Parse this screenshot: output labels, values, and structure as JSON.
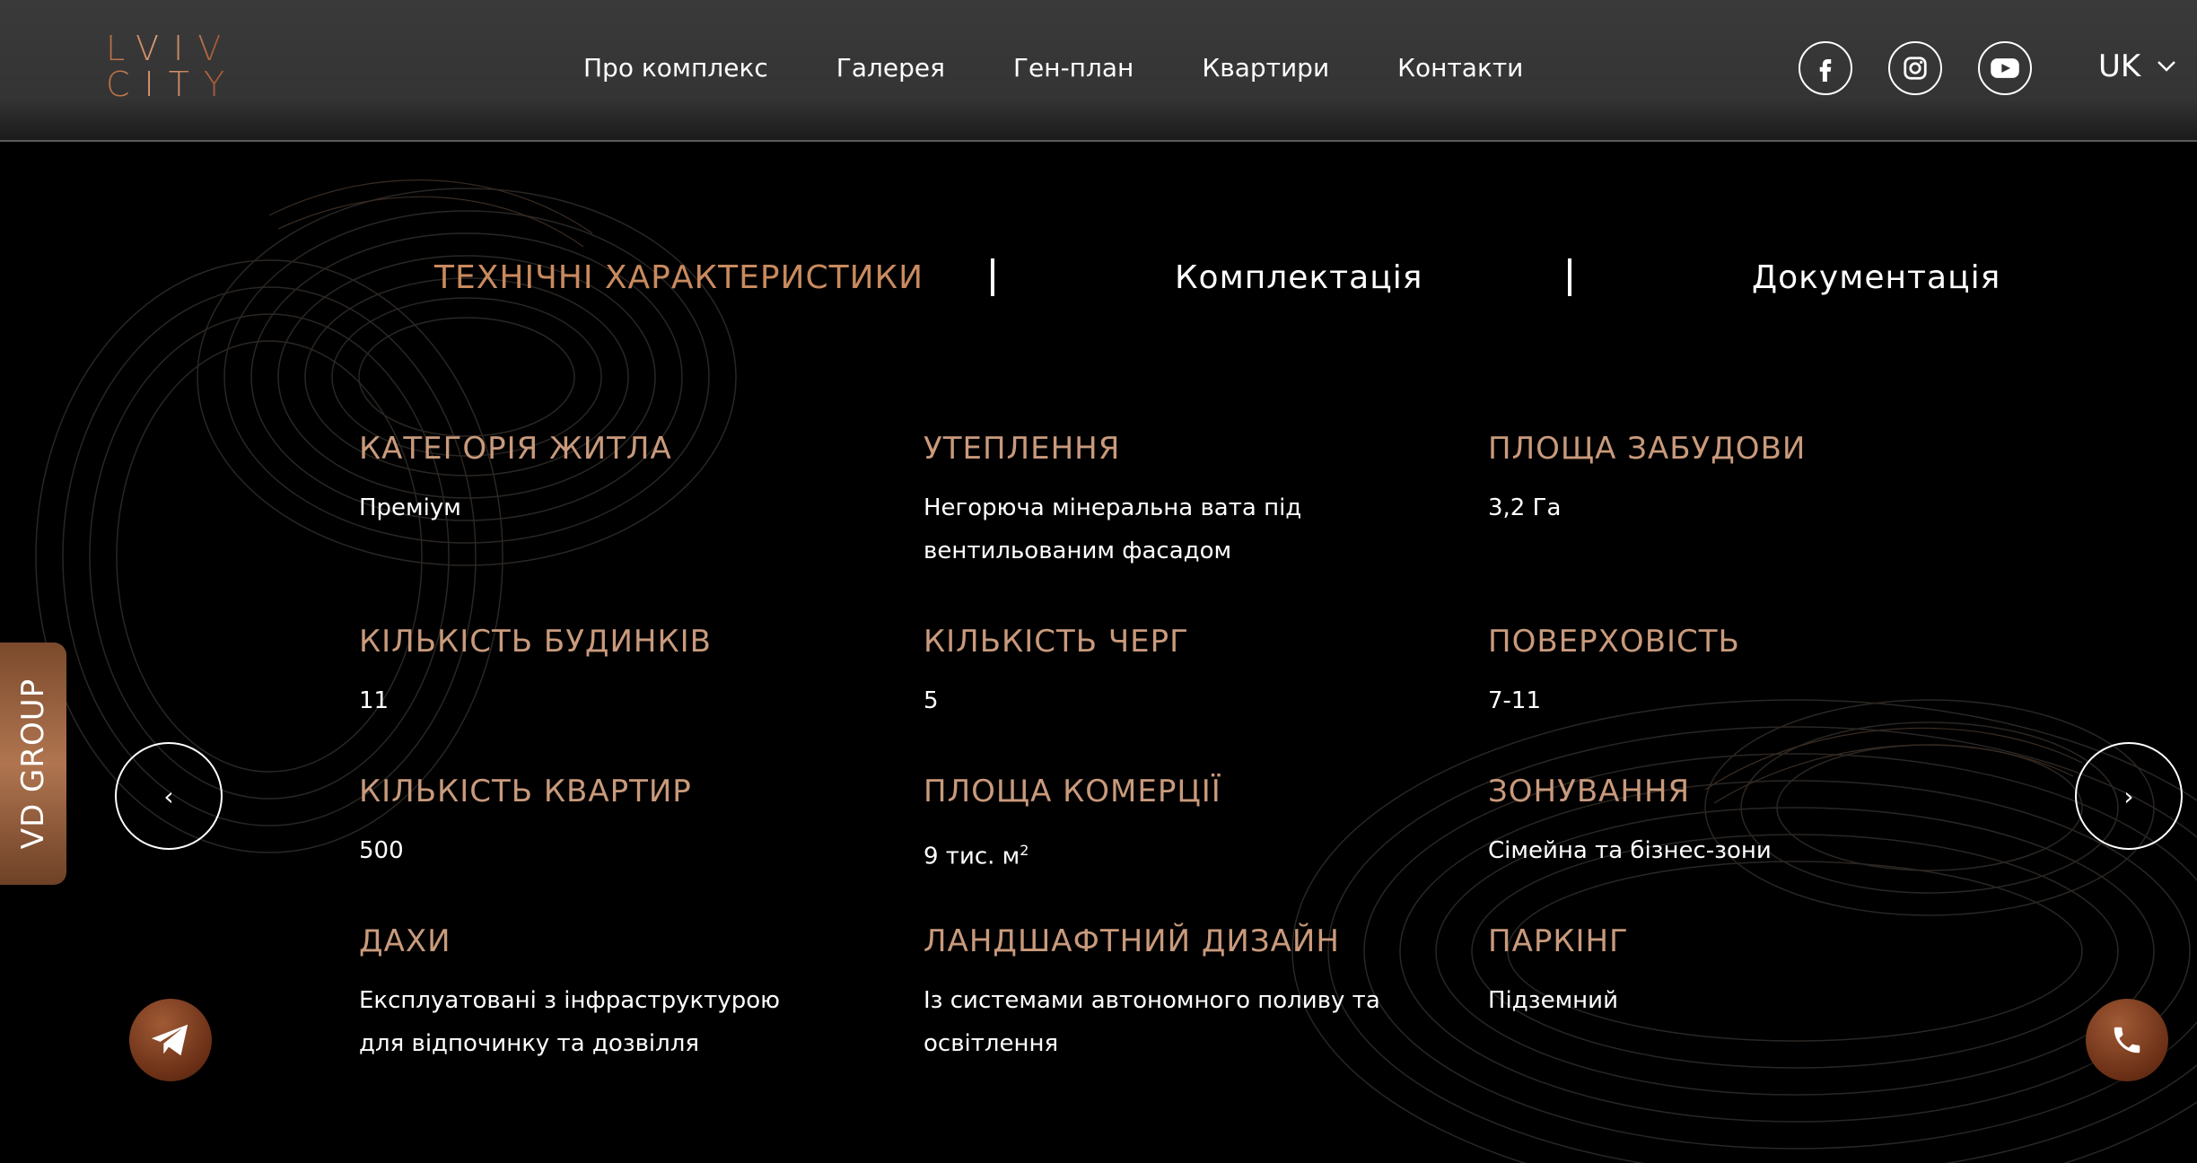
{
  "brand": {
    "logo_line1": "LVIV",
    "logo_line2": "CITY",
    "accent": "#c98a5e",
    "label_color": "#c99a7c"
  },
  "nav": {
    "items": [
      "Про комплекс",
      "Галерея",
      "Ген-план",
      "Квартири",
      "Контакти"
    ]
  },
  "socials": [
    "facebook-icon",
    "instagram-icon",
    "youtube-icon"
  ],
  "language": {
    "current": "UK"
  },
  "tabs": [
    {
      "label": "ТЕХНІЧНІ ХАРАКТЕРИСТИКИ",
      "active": true
    },
    {
      "label": "Комплектація",
      "active": false
    },
    {
      "label": "Документація",
      "active": false
    }
  ],
  "specs": [
    {
      "label": "КАТЕГОРІЯ ЖИТЛА",
      "value": "Преміум"
    },
    {
      "label": "УТЕПЛЕННЯ",
      "value_line1": "Негорюча мінеральна вата під",
      "value_line2": "вентильованим фасадом"
    },
    {
      "label": "ПЛОЩА ЗАБУДОВИ",
      "value": "3,2 Га"
    },
    {
      "label": "КІЛЬКІСТЬ БУДИНКІВ",
      "value": "11"
    },
    {
      "label": "КІЛЬКІСТЬ ЧЕРГ",
      "value": "5"
    },
    {
      "label": "ПОВЕРХОВІСТЬ",
      "value": "7-11"
    },
    {
      "label": "КІЛЬКІСТЬ КВАРТИР",
      "value": "500"
    },
    {
      "label": "ПЛОЩА КОМЕРЦІЇ",
      "value": "9 тис. м",
      "value_sup": "2"
    },
    {
      "label": "ЗОНУВАННЯ",
      "value": "Сімейна та бізнес-зони"
    },
    {
      "label": "ДАХИ",
      "value_line1": "Експлуатовані з інфраструктурою",
      "value_line2": "для відпочинку та дозвілля"
    },
    {
      "label": "ЛАНДШАФТНИЙ ДИЗАЙН",
      "value_line1": "Із системами автономного поливу та",
      "value_line2": "освітлення"
    },
    {
      "label": "ПАРКІНГ",
      "value": "Підземний"
    }
  ],
  "controls": {
    "prev_label": "‹",
    "next_label": "›",
    "vd_badge": "VD GROUP"
  }
}
